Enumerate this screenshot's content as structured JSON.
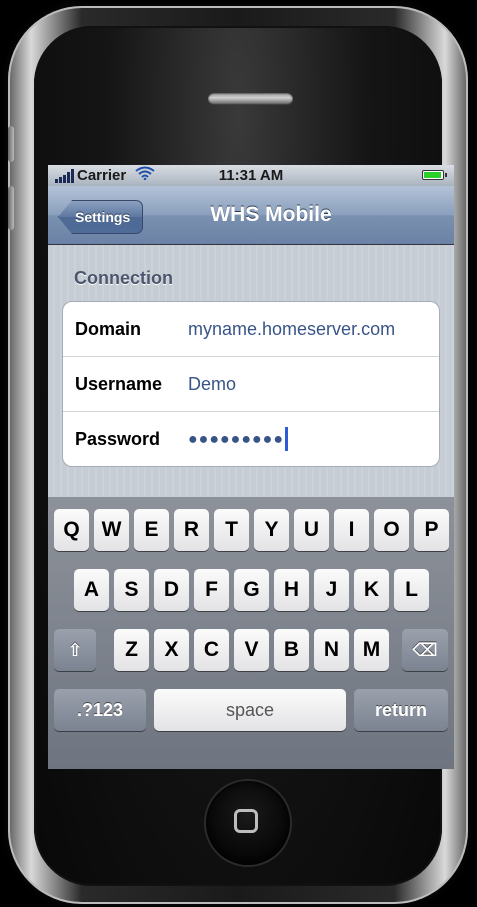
{
  "status_bar": {
    "carrier": "Carrier",
    "time": "11:31 AM",
    "battery_level": 0.95
  },
  "nav": {
    "back_label": "Settings",
    "title": "WHS Mobile"
  },
  "section": {
    "header": "Connection",
    "rows": [
      {
        "label": "Domain",
        "value": "myname.homeserver.com"
      },
      {
        "label": "Username",
        "value": "Demo"
      },
      {
        "label": "Password",
        "value": "●●●●●●●●●"
      }
    ]
  },
  "keyboard": {
    "row1": [
      "Q",
      "W",
      "E",
      "R",
      "T",
      "Y",
      "U",
      "I",
      "O",
      "P"
    ],
    "row2": [
      "A",
      "S",
      "D",
      "F",
      "G",
      "H",
      "J",
      "K",
      "L"
    ],
    "row3": [
      "Z",
      "X",
      "C",
      "V",
      "B",
      "N",
      "M"
    ],
    "shift_icon": "⇧",
    "backspace_icon": "⌫",
    "mode_label": ".?123",
    "space_label": "space",
    "return_label": "return"
  },
  "icons": {
    "signal": "signal-bars-icon",
    "wifi": "wifi-icon",
    "battery": "battery-icon",
    "home": "home-button-icon"
  }
}
